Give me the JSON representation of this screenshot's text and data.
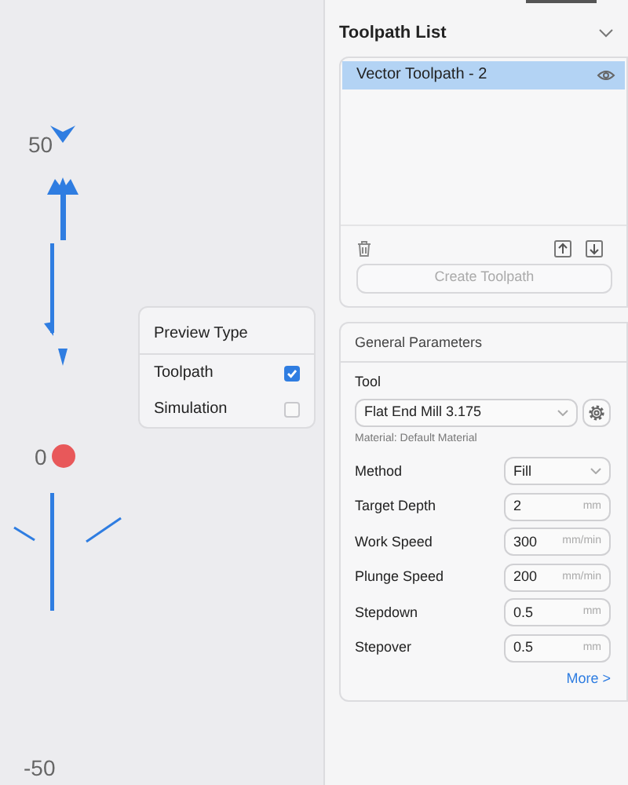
{
  "canvas": {
    "axis_labels": [
      "50",
      "0",
      "-50"
    ]
  },
  "preview_type": {
    "title": "Preview Type",
    "options": [
      {
        "label": "Toolpath",
        "checked": true
      },
      {
        "label": "Simulation",
        "checked": false
      }
    ]
  },
  "toolpath_list": {
    "title": "Toolpath List",
    "items": [
      {
        "label": "Vector Toolpath - 2",
        "selected": true
      }
    ],
    "create_button": {
      "label": "Create Toolpath",
      "disabled": true
    }
  },
  "general_parameters": {
    "title": "General Parameters",
    "tool_label": "Tool",
    "tool": "Flat End Mill 3.175",
    "material": "Material: Default Material",
    "fields": [
      {
        "kind": "select",
        "label": "Method",
        "value": "Fill"
      },
      {
        "kind": "input",
        "label": "Target Depth",
        "value": "2",
        "unit": "mm"
      },
      {
        "kind": "input",
        "label": "Work Speed",
        "value": "300",
        "unit": "mm/min"
      },
      {
        "kind": "input",
        "label": "Plunge Speed",
        "value": "200",
        "unit": "mm/min"
      },
      {
        "kind": "input",
        "label": "Stepdown",
        "value": "0.5",
        "unit": "mm"
      },
      {
        "kind": "input",
        "label": "Stepover",
        "value": "0.5",
        "unit": "mm"
      }
    ],
    "more_link": "More >"
  }
}
